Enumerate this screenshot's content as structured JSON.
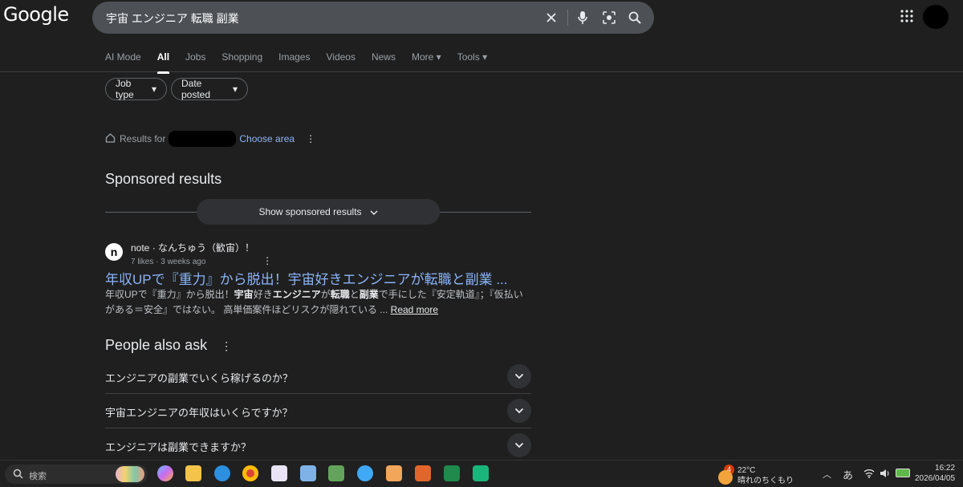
{
  "logo": "Google",
  "search": {
    "query": "宇宙 エンジニア 転職 副業"
  },
  "tabs": [
    "AI Mode",
    "All",
    "Jobs",
    "Shopping",
    "Images",
    "Videos",
    "News",
    "More",
    "Tools"
  ],
  "active_tab": "All",
  "filters": {
    "job_type": "Job type",
    "date_posted": "Date posted"
  },
  "location": {
    "prefix": "Results for",
    "choose_area": "Choose area"
  },
  "sponsored": {
    "heading": "Sponsored results",
    "button": "Show sponsored results"
  },
  "result": {
    "favicon_letter": "n",
    "site": "note · なんちゅう（歓宙）！",
    "meta": "7 likes · 3 weeks ago",
    "title": "年収UPで『重力』から脱出！宇宙好きエンジニアが転職と副業 ...",
    "snippet_a1": "年収UPで『重力』から脱出！",
    "snippet_b1": "宇宙",
    "snippet_a2": "好き",
    "snippet_b2": "エンジニア",
    "snippet_a3": "が",
    "snippet_b3": "転職",
    "snippet_a4": "と",
    "snippet_b4": "副業",
    "snippet_a5": "で手にした『安定軌道』；『仮払いがある＝安全』ではない。 高単価案件ほどリスクが隠れている ...",
    "read_more": "Read more"
  },
  "paa": {
    "heading": "People also ask",
    "questions": [
      "エンジニアの副業でいくら稼げるのか？",
      "宇宙エンジニアの年収はいくらですか？",
      "エンジニアは副業できますか？"
    ]
  },
  "taskbar": {
    "search_placeholder": "検索",
    "weather_badge": "4",
    "weather_temp": "22°C",
    "weather_desc": "晴れのちくもり",
    "ime": "あ",
    "time": "16:22",
    "date": "2026/04/05"
  }
}
